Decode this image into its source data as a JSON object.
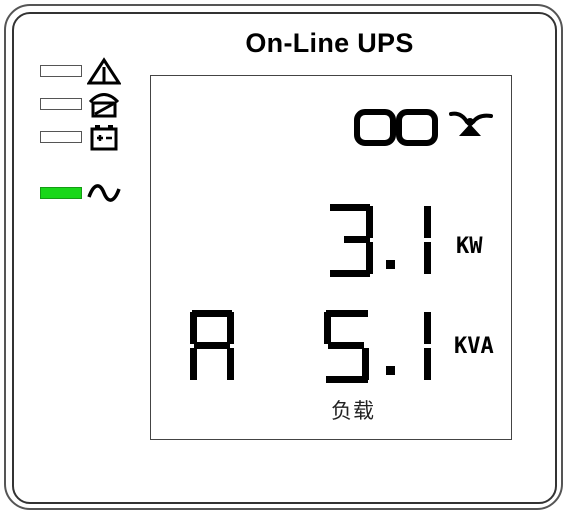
{
  "title": "On-Line UPS",
  "indicators": [
    {
      "icon": "warning-icon",
      "state": "off"
    },
    {
      "icon": "bypass-icon",
      "state": "off"
    },
    {
      "icon": "battery-icon",
      "state": "off"
    },
    {
      "icon": "ac-line-icon",
      "state": "on"
    }
  ],
  "lcd": {
    "top_digits": "00",
    "status_icon": "fan-icon",
    "power": {
      "value": "3.1",
      "unit": "KW"
    },
    "apparent_power": {
      "prefix": "A",
      "value": "5.1",
      "unit": "KVA"
    },
    "load_label": "负载"
  },
  "colors": {
    "led_on": "#19d719",
    "led_off": "#ffffff"
  }
}
